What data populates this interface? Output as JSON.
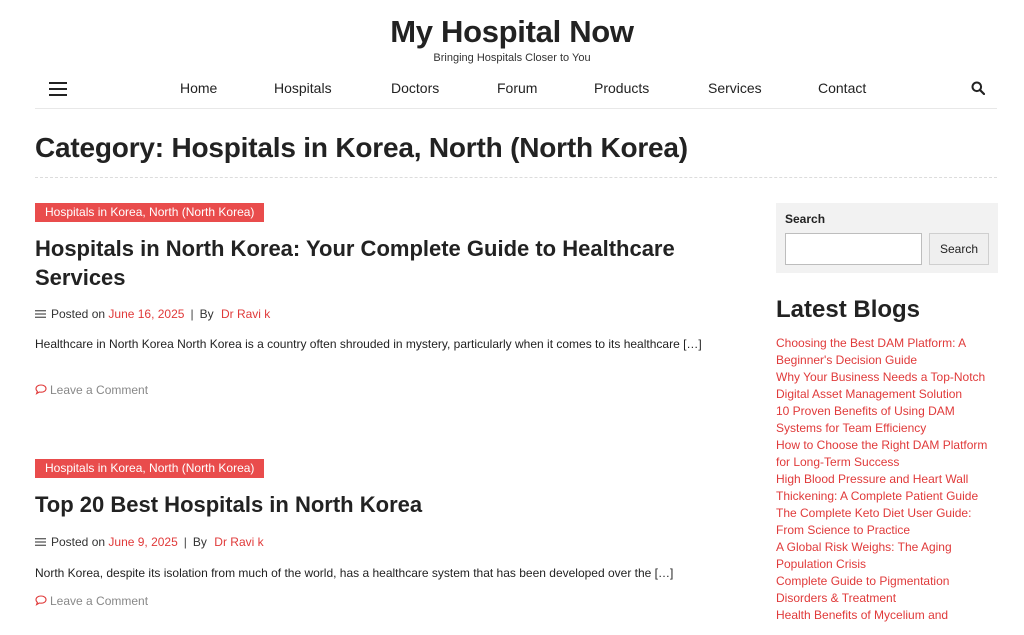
{
  "site": {
    "title": "My Hospital Now",
    "tagline": "Bringing Hospitals Closer to You"
  },
  "nav": {
    "items": [
      "Home",
      "Hospitals",
      "Doctors",
      "Forum",
      "Products",
      "Services",
      "Contact"
    ]
  },
  "page": {
    "title": "Category: Hospitals in Korea, North (North Korea)"
  },
  "posts": [
    {
      "category": "Hospitals in Korea, North (North Korea)",
      "title": "Hospitals in North Korea: Your Complete Guide to Healthcare Services",
      "posted_on_label": "Posted on",
      "date": "June 16, 2025",
      "separator": "|",
      "by_label": "By",
      "author": "Dr Ravi k",
      "excerpt": "Healthcare in North Korea North Korea is a country often shrouded in mystery, particularly when it comes to its healthcare […]",
      "comment_link": "Leave a Comment"
    },
    {
      "category": "Hospitals in Korea, North (North Korea)",
      "title": "Top 20 Best Hospitals in North Korea",
      "posted_on_label": "Posted on",
      "date": "June 9, 2025",
      "separator": "|",
      "by_label": "By",
      "author": "Dr Ravi k",
      "excerpt": "North Korea, despite its isolation from much of the world, has a healthcare system that has been developed over the […]",
      "comment_link": "Leave a Comment"
    }
  ],
  "sidebar": {
    "search": {
      "label": "Search",
      "value": "",
      "button_label": "Search"
    },
    "latest_blogs": {
      "title": "Latest Blogs",
      "items": [
        "Choosing the Best DAM Platform: A Beginner's Decision Guide",
        "Why Your Business Needs a Top-Notch Digital Asset Management Solution",
        "10 Proven Benefits of Using DAM Systems for Team Efficiency",
        "How to Choose the Right DAM Platform for Long-Term Success",
        "High Blood Pressure and Heart Wall Thickening: A Complete Patient Guide",
        "The Complete Keto Diet User Guide: From Science to Practice",
        "A Global Risk Weighs: The Aging Population Crisis",
        "Complete Guide to Pigmentation Disorders & Treatment",
        "Health Benefits of Mycelium and"
      ]
    }
  },
  "colors": {
    "accent": "#e94c4c",
    "link_red": "#e03a3a",
    "text_dark": "#222222",
    "muted": "#888888",
    "sidebar_bg": "#f2f2f2"
  },
  "icons": {
    "menu": "hamburger-icon",
    "search": "search-icon",
    "meta": "list-icon",
    "comment": "comment-icon"
  }
}
